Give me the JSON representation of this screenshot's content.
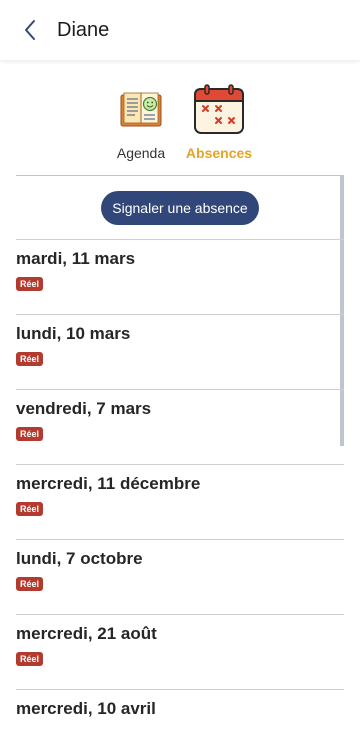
{
  "header": {
    "title": "Diane",
    "back_icon": "chevron-left-icon"
  },
  "tabs": [
    {
      "label": "Agenda",
      "icon": "agenda-book-icon",
      "active": false
    },
    {
      "label": "Absences",
      "icon": "calendar-absences-icon",
      "active": true
    }
  ],
  "colors": {
    "accent": "#e6a423",
    "button": "#324779",
    "badge": "#b33a2e"
  },
  "actions": {
    "report_absence_label": "Signaler une absence"
  },
  "absences": [
    {
      "date": "mardi, 11 mars",
      "badge": "Réel"
    },
    {
      "date": "lundi, 10 mars",
      "badge": "Réel"
    },
    {
      "date": "vendredi, 7 mars",
      "badge": "Réel"
    },
    {
      "date": "mercredi, 11 décembre",
      "badge": "Réel"
    },
    {
      "date": "lundi, 7 octobre",
      "badge": "Réel"
    },
    {
      "date": "mercredi, 21 août",
      "badge": "Réel"
    },
    {
      "date": "mercredi, 10 avril",
      "badge": ""
    }
  ]
}
